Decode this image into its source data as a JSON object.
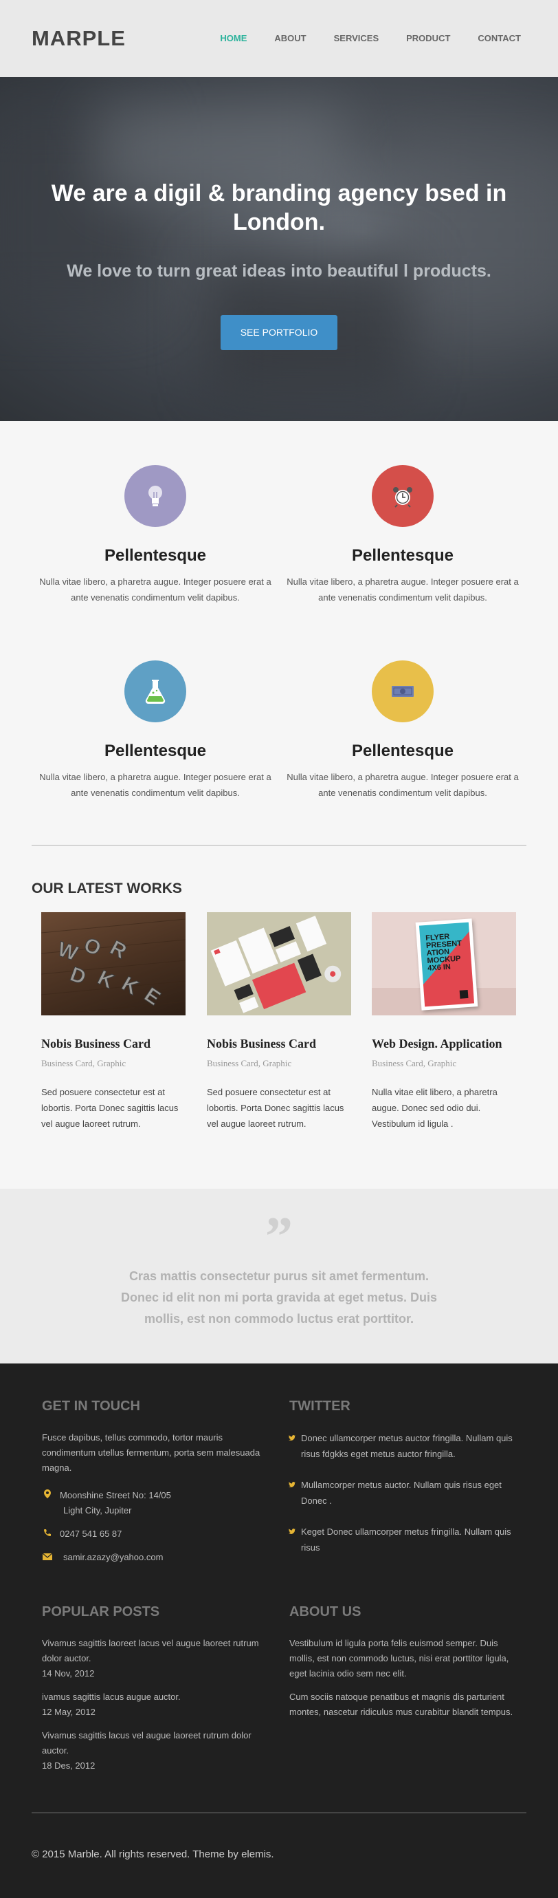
{
  "header": {
    "logo": "MARPLE",
    "nav": [
      "HOME",
      "ABOUT",
      "SERVICES",
      "PRODUCT",
      "CONTACT"
    ]
  },
  "hero": {
    "title": "We are a digil & branding agency bsed in London.",
    "subtitle": "We love to turn great ideas into beautiful l products.",
    "button": "SEE PORTFOLIO"
  },
  "services": [
    {
      "title": "Pellentesque",
      "text": "Nulla vitae libero, a pharetra augue. Integer posuere erat a ante venenatis condimentum velit dapibus.",
      "icon": "lightbulb-icon",
      "color": "#9f99c4"
    },
    {
      "title": "Pellentesque",
      "text": "Nulla vitae libero, a pharetra augue. Integer posuere erat a ante venenatis condimentum velit dapibus.",
      "icon": "alarm-clock-icon",
      "color": "#d44f4a"
    },
    {
      "title": "Pellentesque",
      "text": "Nulla vitae libero, a pharetra augue. Integer posuere erat a ante venenatis condimentum velit dapibus.",
      "icon": "flask-icon",
      "color": "#5fa0c5"
    },
    {
      "title": "Pellentesque",
      "text": "Nulla vitae libero, a pharetra augue. Integer posuere erat a ante venenatis condimentum velit dapibus.",
      "icon": "money-icon",
      "color": "#e8bf4a"
    }
  ],
  "works": {
    "title": "OUR LATEST WORKS",
    "items": [
      {
        "title": "Nobis Business Card",
        "cats": "Business Card, Graphic",
        "text": "Sed posuere consectetur est at lobortis. Porta Donec sagittis lacus vel augue laoreet rutrum."
      },
      {
        "title": "Nobis Business Card",
        "cats": "Business Card, Graphic",
        "text": "Sed posuere consectetur est at lobortis. Porta Donec sagittis lacus vel augue laoreet rutrum."
      },
      {
        "title": "Web Design. Application",
        "cats": "Business Card, Graphic",
        "text": "Nulla vitae elit libero, a pharetra augue. Donec sed odio dui. Vestibulum id ligula ."
      }
    ],
    "poster_text": [
      "FLYER",
      "PRESENT",
      "ATION",
      "MOCKUP",
      "4X6 IN"
    ]
  },
  "quote": {
    "mark": "”",
    "text": "Cras mattis consectetur purus sit amet fermentum. Donec id elit non mi porta gravida at eget metus. Duis mollis, est non commodo luctus erat porttitor."
  },
  "footer": {
    "contact": {
      "title": "GET IN TOUCH",
      "text": "Fusce dapibus, tellus commodo, tortor mauris condimentum utellus fermentum, porta sem malesuada magna.",
      "address1": "Moonshine Street No: 14/05",
      "address2": "Light City, Jupiter",
      "phone": "0247 541 65 87",
      "email": "samir.azazy@yahoo.com"
    },
    "twitter": {
      "title": "TWITTER",
      "tweets": [
        "Donec ullamcorper metus auctor fringilla. Nullam quis risus fdgkks eget metus auctor fringilla.",
        "Mullamcorper metus auctor. Nullam quis risus eget Donec .",
        "Keget Donec ullamcorper metus fringilla. Nullam quis risus"
      ]
    },
    "posts": {
      "title": "POPULAR POSTS",
      "items": [
        {
          "title": "Vivamus sagittis laoreet lacus vel augue laoreet rutrum dolor auctor.",
          "date": "14 Nov, 2012"
        },
        {
          "title": "ivamus sagittis lacus augue auctor.",
          "date": "12 May, 2012"
        },
        {
          "title": "Vivamus sagittis lacus vel augue laoreet rutrum dolor auctor.",
          "date": "18 Des, 2012"
        }
      ]
    },
    "about": {
      "title": "ABOUT US",
      "p1": "Vestibulum id ligula porta felis euismod semper. Duis mollis, est non commodo luctus, nisi erat porttitor ligula, eget lacinia odio sem nec elit.",
      "p2": "Cum sociis natoque penatibus et magnis dis parturient montes, nascetur ridiculus mus curabitur blandit tempus."
    },
    "copyright": "© 2015 Marble. All rights reserved. Theme by elemis."
  }
}
